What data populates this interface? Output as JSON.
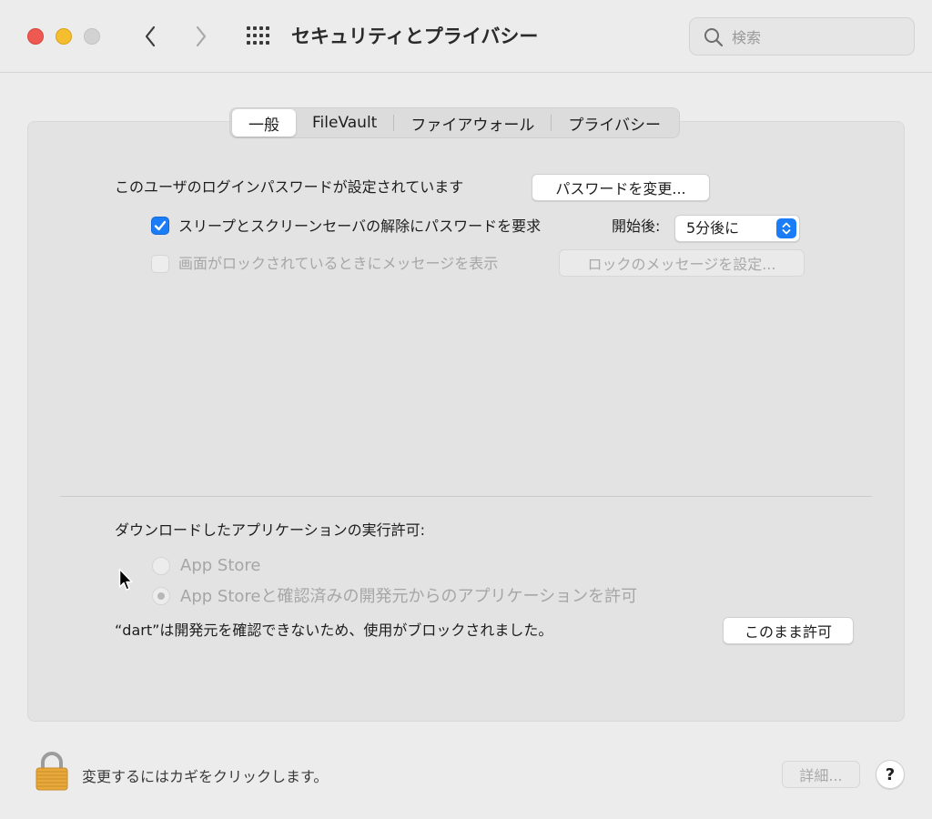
{
  "window": {
    "title": "セキュリティとプライバシー",
    "search_placeholder": "検索"
  },
  "tabs": [
    {
      "label": "一般",
      "active": true
    },
    {
      "label": "FileVault",
      "active": false
    },
    {
      "label": "ファイアウォール",
      "active": false
    },
    {
      "label": "プライバシー",
      "active": false
    }
  ],
  "general": {
    "password_text": "このユーザのログインパスワードが設定されています",
    "change_password_button": "パスワードを変更...",
    "require_password": {
      "label": "スリープとスクリーンセーバの解除にパスワードを要求",
      "checked": true,
      "after_label": "開始後:",
      "after_value": "5分後に"
    },
    "lock_message": {
      "label": "画面がロックされているときにメッセージを表示",
      "checked": false,
      "enabled": false,
      "button": "ロックのメッセージを設定..."
    }
  },
  "downloads": {
    "heading": "ダウンロードしたアプリケーションの実行許可:",
    "options": [
      {
        "label": "App Store",
        "selected": false,
        "enabled": false
      },
      {
        "label": "App Storeと確認済みの開発元からのアプリケーションを許可",
        "selected": true,
        "enabled": false
      }
    ],
    "blocked_message": "“dart”は開発元を確認できないため、使用がブロックされました。",
    "allow_button": "このまま許可"
  },
  "footer": {
    "lock_text": "変更するにはカギをクリックします。",
    "details_button": "詳細...",
    "help_button": "?"
  },
  "colors": {
    "accent": "#1a7cf6",
    "close": "#ee5a52",
    "minimize": "#f5be2f",
    "lock": "#e8a93a"
  }
}
